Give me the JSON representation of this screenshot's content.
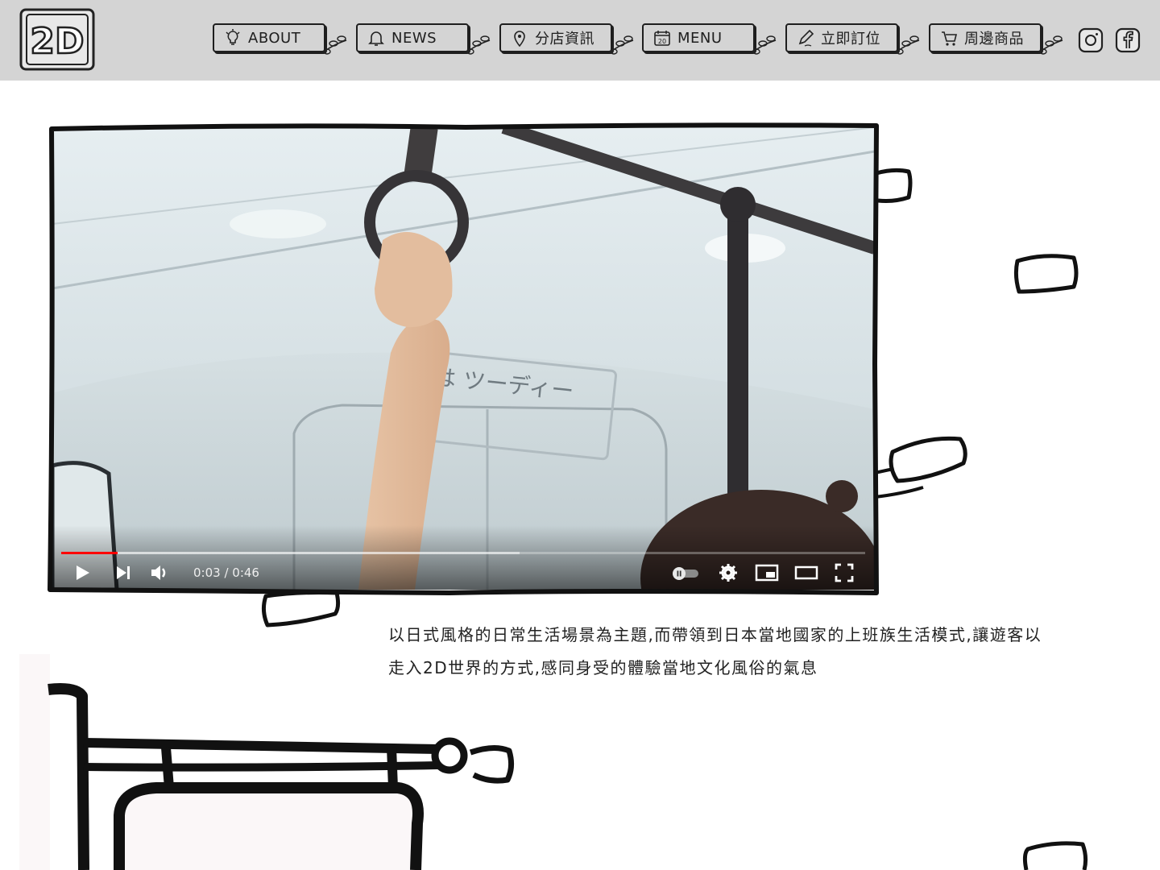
{
  "header": {
    "logo_text": "2D",
    "nav": [
      {
        "label": "ABOUT",
        "icon": "lightbulb-icon"
      },
      {
        "label": "NEWS",
        "icon": "bell-icon"
      },
      {
        "label": "分店資訊",
        "icon": "map-pin-icon"
      },
      {
        "label": "MENU",
        "icon": "calendar-icon"
      },
      {
        "label": "立即訂位",
        "icon": "pencil-icon"
      },
      {
        "label": "周邊商品",
        "icon": "cart-icon"
      }
    ],
    "social": [
      {
        "icon": "instagram-icon"
      },
      {
        "icon": "facebook-icon"
      }
    ]
  },
  "video": {
    "current_time": "0:03",
    "duration": "0:46",
    "time_display": "0:03 / 0:46",
    "progress_fraction": 0.07,
    "buffered_fraction": 0.57,
    "progress_color": "#ff0000",
    "overlay_text": "は ツーディー"
  },
  "description": {
    "line1": "以日式風格的日常生活場景為主題,而帶領到日本當地國家的上班族生活模式,讓遊客以",
    "line2": "走入2D世界的方式,感同身受的體驗當地文化風俗的氣息"
  }
}
